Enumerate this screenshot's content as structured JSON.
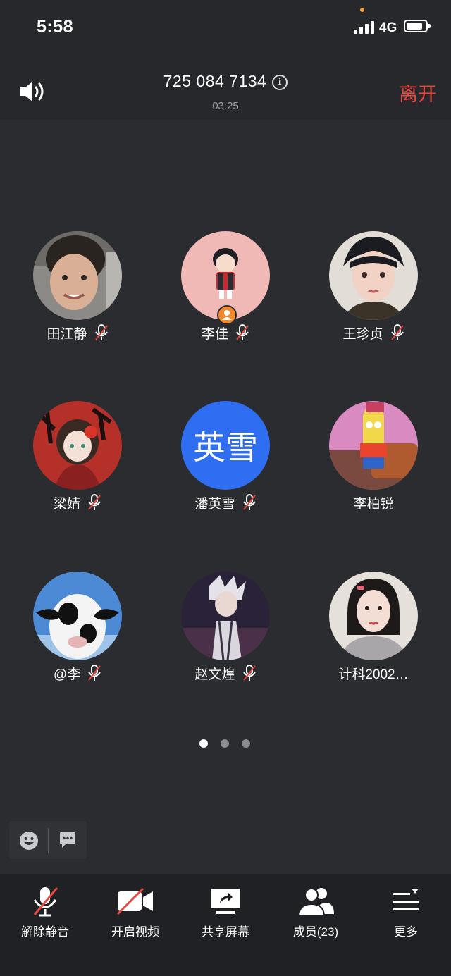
{
  "status": {
    "time": "5:58",
    "network": "4G"
  },
  "header": {
    "meeting_id": "725 084 7134",
    "timer": "03:25",
    "leave_label": "离开"
  },
  "participants": [
    {
      "name": "田江静",
      "muted": true
    },
    {
      "name": "李佳",
      "muted": true,
      "host": true
    },
    {
      "name": "王珍贞",
      "muted": true
    },
    {
      "name": "梁婧",
      "muted": true
    },
    {
      "name": "潘英雪",
      "muted": true,
      "avatar_text": "英雪"
    },
    {
      "name": "李柏锐",
      "muted": false
    },
    {
      "name": "@李",
      "muted": true
    },
    {
      "name": "赵文煌",
      "muted": true
    },
    {
      "name": "计科2002…",
      "muted": false
    }
  ],
  "pagination": {
    "pages": 3,
    "current": 1
  },
  "toolbar": {
    "unmute_label": "解除静音",
    "video_label": "开启视频",
    "share_label": "共享屏幕",
    "members_label": "成员(23)",
    "more_label": "更多"
  },
  "colors": {
    "accent_blue": "#2f6ef0",
    "leave_red": "#e8483f",
    "host_orange": "#f28a2c"
  }
}
